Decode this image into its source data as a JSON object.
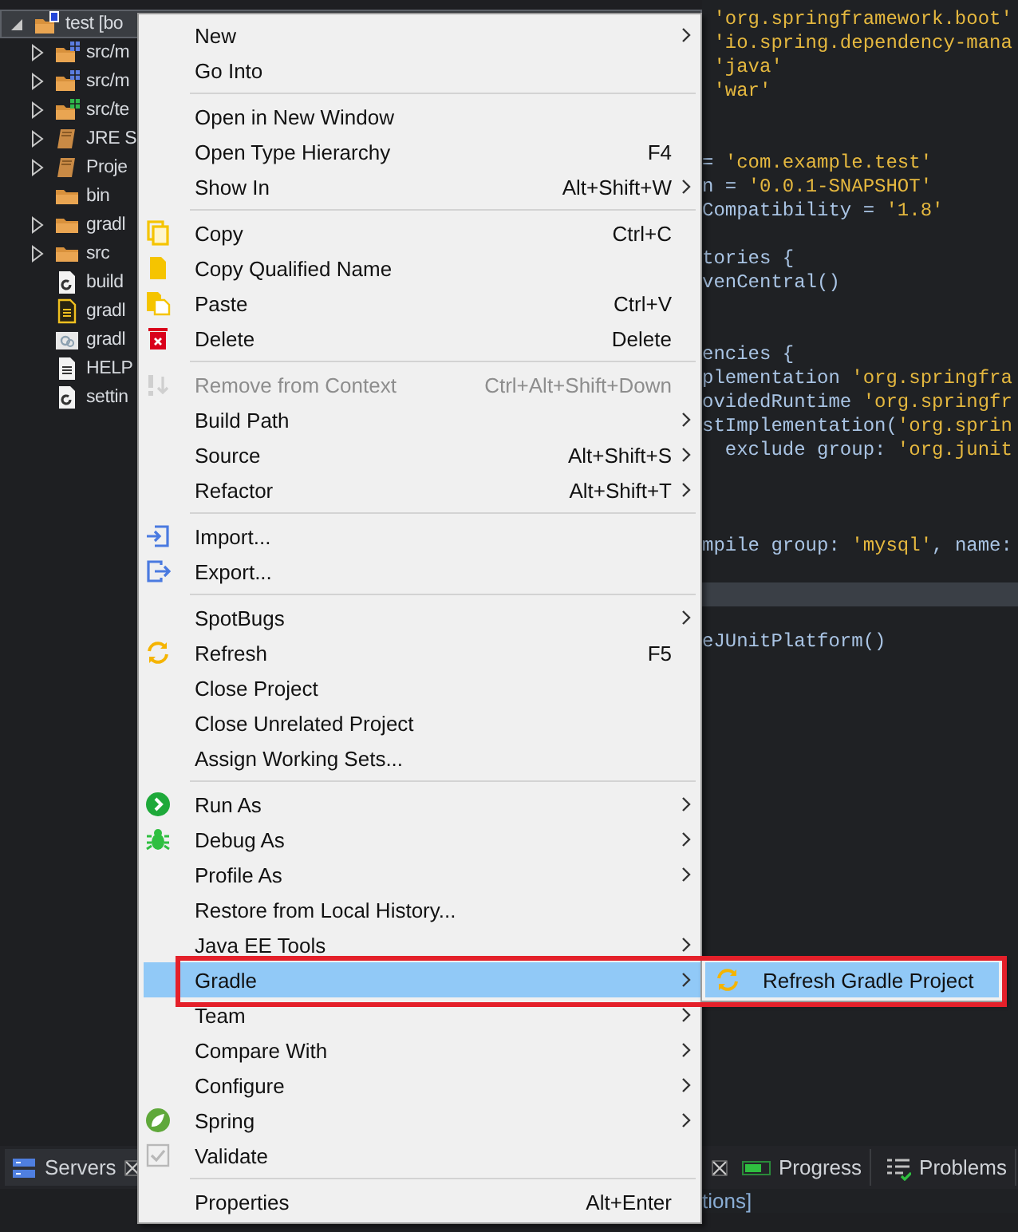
{
  "tree": [
    {
      "label": "test [bo",
      "expanded": true,
      "selected": true,
      "children": [
        {
          "label": "src/m",
          "expanded": false,
          "selected": false
        },
        {
          "label": "src/m",
          "expanded": false,
          "selected": false
        },
        {
          "label": "src/te",
          "expanded": false,
          "selected": false
        },
        {
          "label": "JRE S",
          "expanded": false,
          "selected": false
        },
        {
          "label": "Proje",
          "expanded": false,
          "selected": false
        },
        {
          "label": "bin",
          "selected": false
        },
        {
          "label": "gradl",
          "expanded": false,
          "selected": false
        },
        {
          "label": "src",
          "expanded": false,
          "selected": false
        },
        {
          "label": "build",
          "selected": false
        },
        {
          "label": "gradl",
          "selected": false
        },
        {
          "label": "gradl",
          "selected": false
        },
        {
          "label": "HELP",
          "selected": false
        },
        {
          "label": "settin",
          "selected": false
        }
      ]
    }
  ],
  "editor": {
    "lines": [
      {
        "kind": "code",
        "current": false,
        "segments": [
          {
            "text": " 'org.springframework.boot'",
            "kind": "string"
          }
        ]
      },
      {
        "kind": "code",
        "current": false,
        "segments": [
          {
            "text": " 'io.spring.dependency-mana",
            "kind": "string"
          }
        ]
      },
      {
        "kind": "code",
        "current": false,
        "segments": [
          {
            "text": " 'java'",
            "kind": "string"
          }
        ]
      },
      {
        "kind": "code",
        "current": false,
        "segments": [
          {
            "text": " 'war'",
            "kind": "string"
          }
        ]
      },
      {
        "kind": "blank",
        "current": false
      },
      {
        "kind": "blank",
        "current": false
      },
      {
        "kind": "code",
        "current": false,
        "segments": [
          {
            "text": "= ",
            "kind": "plain"
          },
          {
            "text": "'com.example.test'",
            "kind": "string"
          }
        ]
      },
      {
        "kind": "code",
        "current": false,
        "segments": [
          {
            "text": "n = ",
            "kind": "plain"
          },
          {
            "text": "'0.0.1-SNAPSHOT'",
            "kind": "string"
          }
        ]
      },
      {
        "kind": "code",
        "current": false,
        "segments": [
          {
            "text": "Compatibility = ",
            "kind": "plain"
          },
          {
            "text": "'1.8'",
            "kind": "string"
          }
        ]
      },
      {
        "kind": "blank",
        "current": false
      },
      {
        "kind": "code",
        "current": false,
        "segments": [
          {
            "text": "tories {",
            "kind": "plain"
          }
        ]
      },
      {
        "kind": "code",
        "current": false,
        "segments": [
          {
            "text": "venCentral()",
            "kind": "plain"
          }
        ]
      },
      {
        "kind": "blank",
        "current": false
      },
      {
        "kind": "blank",
        "current": false
      },
      {
        "kind": "code",
        "current": false,
        "segments": [
          {
            "text": "encies {",
            "kind": "plain"
          }
        ]
      },
      {
        "kind": "code",
        "current": false,
        "segments": [
          {
            "text": "plementation ",
            "kind": "plain"
          },
          {
            "text": "'org.springfra",
            "kind": "string"
          }
        ]
      },
      {
        "kind": "code",
        "current": false,
        "segments": [
          {
            "text": "ovidedRuntime ",
            "kind": "plain"
          },
          {
            "text": "'org.springfr",
            "kind": "string"
          }
        ]
      },
      {
        "kind": "code",
        "current": false,
        "segments": [
          {
            "text": "stImplementation(",
            "kind": "plain"
          },
          {
            "text": "'org.sprin",
            "kind": "string"
          }
        ]
      },
      {
        "kind": "code",
        "current": false,
        "segments": [
          {
            "text": "  exclude group: ",
            "kind": "plain"
          },
          {
            "text": "'org.junit",
            "kind": "string"
          }
        ]
      },
      {
        "kind": "blank",
        "current": false
      },
      {
        "kind": "blank",
        "current": false
      },
      {
        "kind": "blank",
        "current": false
      },
      {
        "kind": "code",
        "current": false,
        "segments": [
          {
            "text": "mpile group: ",
            "kind": "plain"
          },
          {
            "text": "'mysql'",
            "kind": "string"
          },
          {
            "text": ", name:",
            "kind": "plain"
          }
        ]
      },
      {
        "kind": "blank",
        "current": false
      },
      {
        "kind": "blank",
        "current": true
      },
      {
        "kind": "blank",
        "current": false
      },
      {
        "kind": "code",
        "current": false,
        "segments": [
          {
            "text": "eJUnitPlatform()",
            "kind": "plain"
          }
        ]
      }
    ]
  },
  "menu": {
    "items": [
      {
        "kind": "item",
        "label": "New",
        "submenu": true,
        "disabled": false,
        "selected": false
      },
      {
        "kind": "item",
        "label": "Go Into",
        "submenu": false,
        "disabled": false,
        "selected": false
      },
      {
        "kind": "separator"
      },
      {
        "kind": "item",
        "label": "Open in New Window",
        "submenu": false,
        "disabled": false,
        "selected": false
      },
      {
        "kind": "item",
        "label": "Open Type Hierarchy",
        "shortcut": "F4",
        "submenu": false,
        "disabled": false,
        "selected": false
      },
      {
        "kind": "item",
        "label": "Show In",
        "shortcut": "Alt+Shift+W",
        "submenu": true,
        "disabled": false,
        "selected": false
      },
      {
        "kind": "separator"
      },
      {
        "kind": "item",
        "label": "Copy",
        "shortcut": "Ctrl+C",
        "submenu": false,
        "disabled": false,
        "selected": false
      },
      {
        "kind": "item",
        "label": "Copy Qualified Name",
        "submenu": false,
        "disabled": false,
        "selected": false
      },
      {
        "kind": "item",
        "label": "Paste",
        "shortcut": "Ctrl+V",
        "submenu": false,
        "disabled": false,
        "selected": false
      },
      {
        "kind": "item",
        "label": "Delete",
        "shortcut": "Delete",
        "submenu": false,
        "disabled": false,
        "selected": false
      },
      {
        "kind": "separator"
      },
      {
        "kind": "item",
        "label": "Remove from Context",
        "shortcut": "Ctrl+Alt+Shift+Down",
        "submenu": false,
        "disabled": true,
        "selected": false
      },
      {
        "kind": "item",
        "label": "Build Path",
        "submenu": true,
        "disabled": false,
        "selected": false
      },
      {
        "kind": "item",
        "label": "Source",
        "shortcut": "Alt+Shift+S",
        "submenu": true,
        "disabled": false,
        "selected": false
      },
      {
        "kind": "item",
        "label": "Refactor",
        "shortcut": "Alt+Shift+T",
        "submenu": true,
        "disabled": false,
        "selected": false
      },
      {
        "kind": "separator"
      },
      {
        "kind": "item",
        "label": "Import...",
        "submenu": false,
        "disabled": false,
        "selected": false
      },
      {
        "kind": "item",
        "label": "Export...",
        "submenu": false,
        "disabled": false,
        "selected": false
      },
      {
        "kind": "separator"
      },
      {
        "kind": "item",
        "label": "SpotBugs",
        "submenu": true,
        "disabled": false,
        "selected": false
      },
      {
        "kind": "item",
        "label": "Refresh",
        "shortcut": "F5",
        "submenu": false,
        "disabled": false,
        "selected": false
      },
      {
        "kind": "item",
        "label": "Close Project",
        "submenu": false,
        "disabled": false,
        "selected": false
      },
      {
        "kind": "item",
        "label": "Close Unrelated Project",
        "submenu": false,
        "disabled": false,
        "selected": false
      },
      {
        "kind": "item",
        "label": "Assign Working Sets...",
        "submenu": false,
        "disabled": false,
        "selected": false
      },
      {
        "kind": "separator"
      },
      {
        "kind": "item",
        "label": "Run As",
        "submenu": true,
        "disabled": false,
        "selected": false
      },
      {
        "kind": "item",
        "label": "Debug As",
        "submenu": true,
        "disabled": false,
        "selected": false
      },
      {
        "kind": "item",
        "label": "Profile As",
        "submenu": true,
        "disabled": false,
        "selected": false
      },
      {
        "kind": "item",
        "label": "Restore from Local History...",
        "submenu": false,
        "disabled": false,
        "selected": false
      },
      {
        "kind": "item",
        "label": "Java EE Tools",
        "submenu": true,
        "disabled": false,
        "selected": false
      },
      {
        "kind": "item",
        "label": "Gradle",
        "submenu": true,
        "disabled": false,
        "selected": true
      },
      {
        "kind": "item",
        "label": "Team",
        "submenu": true,
        "disabled": false,
        "selected": false
      },
      {
        "kind": "item",
        "label": "Compare With",
        "submenu": true,
        "disabled": false,
        "selected": false
      },
      {
        "kind": "item",
        "label": "Configure",
        "submenu": true,
        "disabled": false,
        "selected": false
      },
      {
        "kind": "item",
        "label": "Spring",
        "submenu": true,
        "disabled": false,
        "selected": false
      },
      {
        "kind": "item",
        "label": "Validate",
        "submenu": false,
        "disabled": false,
        "selected": false
      },
      {
        "kind": "separator"
      },
      {
        "kind": "item",
        "label": "Properties",
        "shortcut": "Alt+Enter",
        "submenu": false,
        "disabled": false,
        "selected": false
      }
    ]
  },
  "submenu": {
    "items": [
      {
        "label": "Refresh Gradle Project",
        "selected": true
      }
    ]
  },
  "bottom_left": {
    "tabs": [
      {
        "label": "Servers",
        "closable": true
      }
    ]
  },
  "bottom_right": {
    "tabs": [
      {
        "kind": "clipped",
        "closable": true
      },
      {
        "kind": "tab",
        "label": "Progress",
        "closable": false
      },
      {
        "kind": "tab",
        "label": "Problems",
        "closable": false
      }
    ],
    "status_text": "tions]"
  }
}
